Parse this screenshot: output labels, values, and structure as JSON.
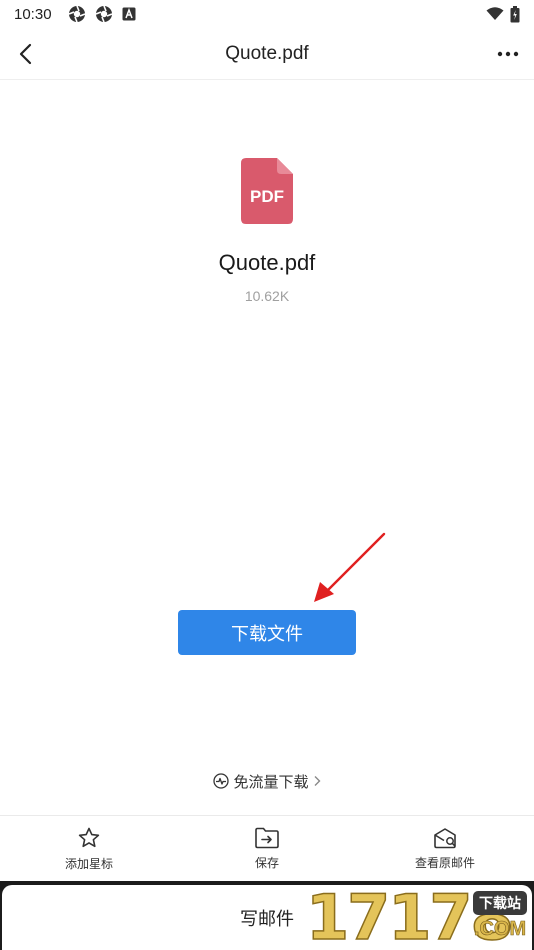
{
  "status_bar": {
    "time": "10:30",
    "left_icons": [
      "aperture-icon",
      "aperture-icon",
      "android-a-icon"
    ],
    "right_icons": [
      "wifi-icon",
      "battery-icon"
    ]
  },
  "header": {
    "title": "Quote.pdf",
    "back_icon": "chevron-left-icon",
    "more_icon": "more-horizontal-icon"
  },
  "file": {
    "icon_label": "PDF",
    "icon_color": "#d95a6c",
    "name": "Quote.pdf",
    "size": "10.62K"
  },
  "annotation": {
    "arrow_color": "#e02020"
  },
  "download_button": {
    "label": "下载文件",
    "color": "#2f86e8"
  },
  "free_download": {
    "label": "免流量下载"
  },
  "bottom_actions": [
    {
      "label": "添加星标",
      "icon": "star-icon"
    },
    {
      "label": "保存",
      "icon": "save-folder-icon"
    },
    {
      "label": "查看原邮件",
      "icon": "mail-search-icon"
    }
  ],
  "compose": {
    "label": "写邮件"
  },
  "watermark": {
    "digits": "17178",
    "badge": "下载站",
    "domain": ".COM"
  }
}
